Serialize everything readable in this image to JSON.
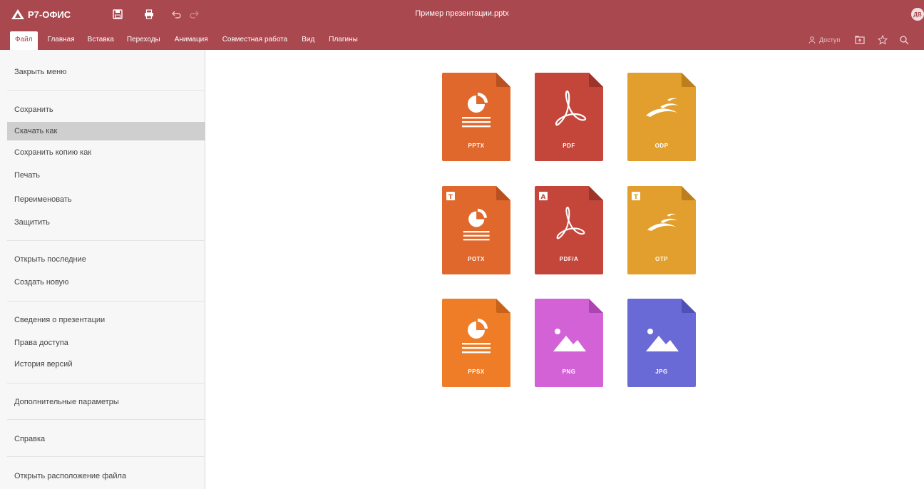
{
  "app": {
    "name": "Р7-ОФИС",
    "doc_title": "Пример презентации.pptx",
    "user_initials": "ДВ"
  },
  "tabs": [
    "Файл",
    "Главная",
    "Вставка",
    "Переходы",
    "Анимация",
    "Совместная работа",
    "Вид",
    "Плагины"
  ],
  "toolbar_right": {
    "access_label": "Доступ"
  },
  "menu": {
    "close": "Закрыть меню",
    "save": "Сохранить",
    "download_as": "Скачать как",
    "save_copy_as": "Сохранить копию как",
    "print": "Печать",
    "rename": "Переименовать",
    "protect": "Защитить",
    "open_recent": "Открыть последние",
    "create_new": "Создать новую",
    "info": "Сведения о презентации",
    "access_rights": "Права доступа",
    "version_history": "История версий",
    "advanced": "Дополнительные параметры",
    "help": "Справка",
    "open_location": "Открыть расположение файла"
  },
  "formats": [
    {
      "label": "PPTX",
      "color": "#e0682c",
      "fold": "#b9501f",
      "icon": "pie",
      "badge": ""
    },
    {
      "label": "PDF",
      "color": "#c4463b",
      "fold": "#9b342b",
      "icon": "acrobat",
      "badge": ""
    },
    {
      "label": "ODP",
      "color": "#e39f2d",
      "fold": "#bc7f1d",
      "icon": "gulls",
      "badge": ""
    },
    {
      "label": "POTX",
      "color": "#e0682c",
      "fold": "#b9501f",
      "icon": "pie",
      "badge": "T"
    },
    {
      "label": "PDF/A",
      "color": "#c4463b",
      "fold": "#9b342b",
      "icon": "acrobat",
      "badge": "A"
    },
    {
      "label": "OTP",
      "color": "#e39f2d",
      "fold": "#bc7f1d",
      "icon": "gulls",
      "badge": "T"
    },
    {
      "label": "PPSX",
      "color": "#ef7d27",
      "fold": "#c86219",
      "icon": "pie",
      "badge": ""
    },
    {
      "label": "PNG",
      "color": "#d462d7",
      "fold": "#ad45b0",
      "icon": "image",
      "badge": ""
    },
    {
      "label": "JPG",
      "color": "#6a6ad6",
      "fold": "#5050b5",
      "icon": "image",
      "badge": ""
    }
  ]
}
